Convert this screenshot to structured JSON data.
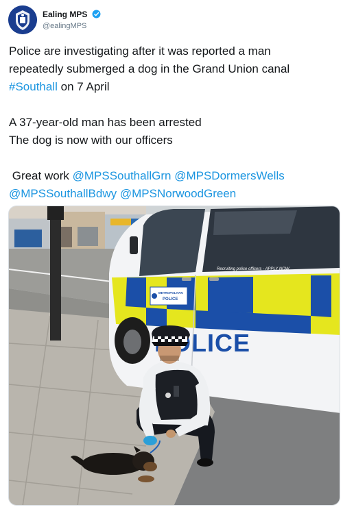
{
  "account": {
    "display_name": "Ealing MPS",
    "handle": "@ealingMPS",
    "verified_icon": "verified-badge-icon",
    "avatar_icon": "met-police-crest-icon"
  },
  "tweet": {
    "line1": "Police are investigating after it was reported a man",
    "line2": "repeatedly submerged a dog in the Grand Union canal",
    "hashtag": "#Southall",
    "line3_rest": " on 7 April",
    "line4": "A 37-year-old man has been arrested",
    "line5": "The dog is now with our officers",
    "line6_prefix": " Great work ",
    "mention1": "@MPSSouthallGrn",
    "mention2": "@MPSDormersWells",
    "mention3": "@MPSSouthallBdwy",
    "mention4": "@MPSNorwoodGreen"
  },
  "photo": {
    "van_text": "POLICE",
    "window_text": "Recruiting police officers - APPLY NOW",
    "badge_line1": "METROPOLITAN",
    "badge_line2": "POLICE"
  },
  "colors": {
    "link": "#1b95e0",
    "police_blue": "#1b4fa8",
    "battenburg_yellow": "#e5e61e"
  }
}
